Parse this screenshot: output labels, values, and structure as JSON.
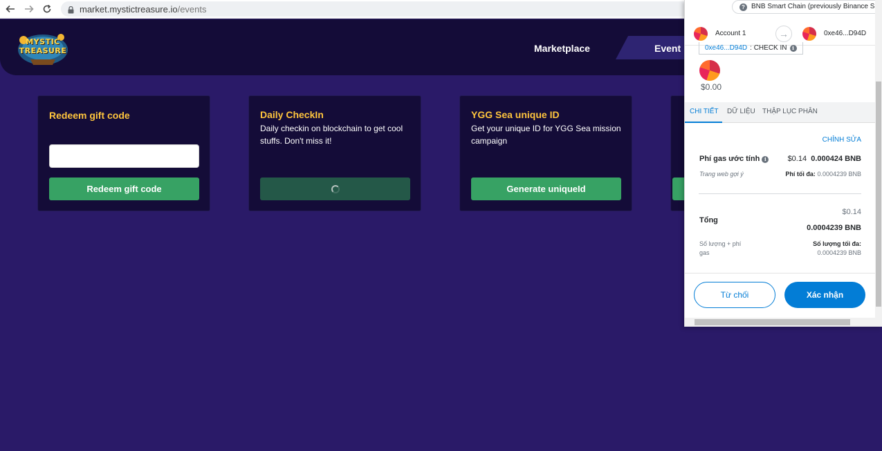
{
  "browser": {
    "url_host": "market.mystictreasure.io",
    "url_path": "/events"
  },
  "site": {
    "logo_text_1": "MYSTIC",
    "logo_text_2": "TREASURE",
    "nav": {
      "marketplace": "Marketplace",
      "event": "Event"
    }
  },
  "cards": [
    {
      "title": "Redeem gift code",
      "input_value": "",
      "button": "Redeem gift code"
    },
    {
      "title": "Daily CheckIn",
      "description": "Daily checkin on blockchain to get cool stuffs. Don't miss it!",
      "button": ""
    },
    {
      "title": "YGG Sea unique ID",
      "description": "Get your unique ID for YGG Sea mission campaign",
      "button": "Generate uniqueId"
    }
  ],
  "wallet": {
    "network": "BNB Smart Chain (previously Binance Smart Chain Mainnet)",
    "account_name": "Account 1",
    "recipient": "0xe46...D94D",
    "method_address": "0xe46...D94D",
    "method_name": ": CHECK IN",
    "amount_usd": "$0.00",
    "tabs": [
      "CHI TIẾT",
      "DỮ LIỆU",
      "THẬP LỤC PHÂN"
    ],
    "edit": "CHỈNH SỬA",
    "gas_label": "Phí gas ước tính",
    "gas_usd": "$0.14",
    "gas_bnb": "0.000424 BNB",
    "site_suggested": "Trang web gợi ý",
    "max_fee_label": "Phí tối đa:",
    "max_fee_value": "0.0004239 BNB",
    "total_label": "Tổng",
    "total_usd": "$0.14",
    "total_bnb": "0.0004239 BNB",
    "amount_plus_gas": "Số lượng + phí gas",
    "max_amount_label": "Số lượng tối đa:",
    "max_amount_value": "0.0004239 BNB",
    "reject": "Từ chối",
    "confirm": "Xác nhận"
  },
  "colors": {
    "page_bg": "#2a1a68",
    "header_bg": "#140c38",
    "card_title": "#ffc53d",
    "green_button": "#37a264",
    "metamask_blue": "#037dd6"
  }
}
